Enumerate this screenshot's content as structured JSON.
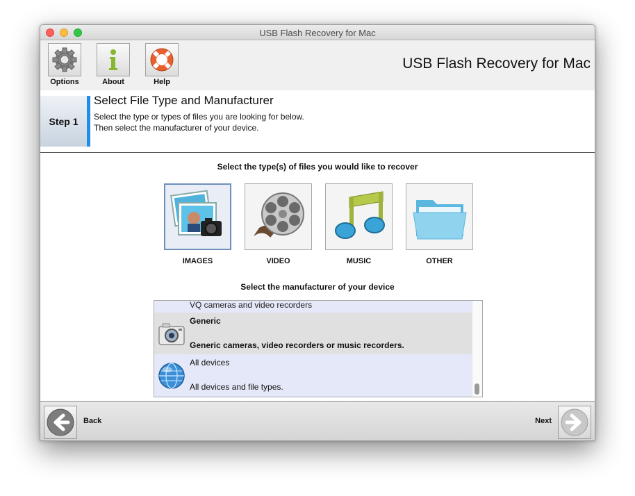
{
  "window": {
    "title": "USB Flash Recovery for Mac"
  },
  "toolbar": {
    "buttons": [
      {
        "label": "Options",
        "icon": "gear-icon"
      },
      {
        "label": "About",
        "icon": "info-icon"
      },
      {
        "label": "Help",
        "icon": "lifebuoy-icon"
      }
    ],
    "app_name": "USB Flash Recovery for Mac"
  },
  "step": {
    "tab_label": "Step 1",
    "title": "Select File Type and Manufacturer",
    "desc_line1": "Select the type or types of files you are looking for below.",
    "desc_line2": "Then select the manufacturer of your device.",
    "accent_color": "#1f8ee6"
  },
  "file_types": {
    "heading": "Select the type(s) of files you would like to recover",
    "items": [
      {
        "label": "IMAGES",
        "icon": "images-icon",
        "selected": true
      },
      {
        "label": "VIDEO",
        "icon": "film-reel-icon",
        "selected": false
      },
      {
        "label": "MUSIC",
        "icon": "music-notes-icon",
        "selected": false
      },
      {
        "label": "OTHER",
        "icon": "folder-icon",
        "selected": false
      }
    ]
  },
  "manufacturer": {
    "heading": "Select the manufacturer of your device",
    "partial_row": "VQ cameras and video recorders",
    "rows": [
      {
        "name": "Generic",
        "desc": "Generic cameras, video recorders or music recorders.",
        "icon": "camera-icon",
        "selected": true
      },
      {
        "name": "All devices",
        "desc": "All devices and file types.",
        "icon": "globe-icon",
        "selected": false
      }
    ]
  },
  "nav": {
    "back_label": "Back",
    "next_label": "Next"
  }
}
